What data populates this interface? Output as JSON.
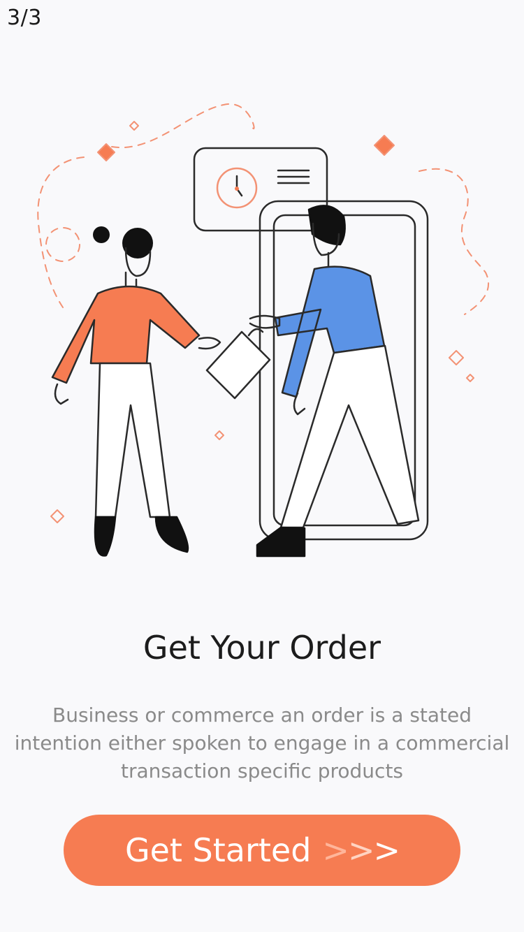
{
  "pager": {
    "text": "3/3"
  },
  "onboarding": {
    "title": "Get Your Order",
    "description_lines": [
      "Business or commerce an order is a stated",
      "intention either spoken to engage in a commercial",
      "transaction specific products"
    ]
  },
  "cta": {
    "label": "Get Started",
    "arrow1": ">",
    "arrow2": ">",
    "arrow3": ">"
  },
  "colors": {
    "accent": "#f67c52",
    "shirt_blue": "#5b93e6",
    "background": "#f9f9fb"
  }
}
